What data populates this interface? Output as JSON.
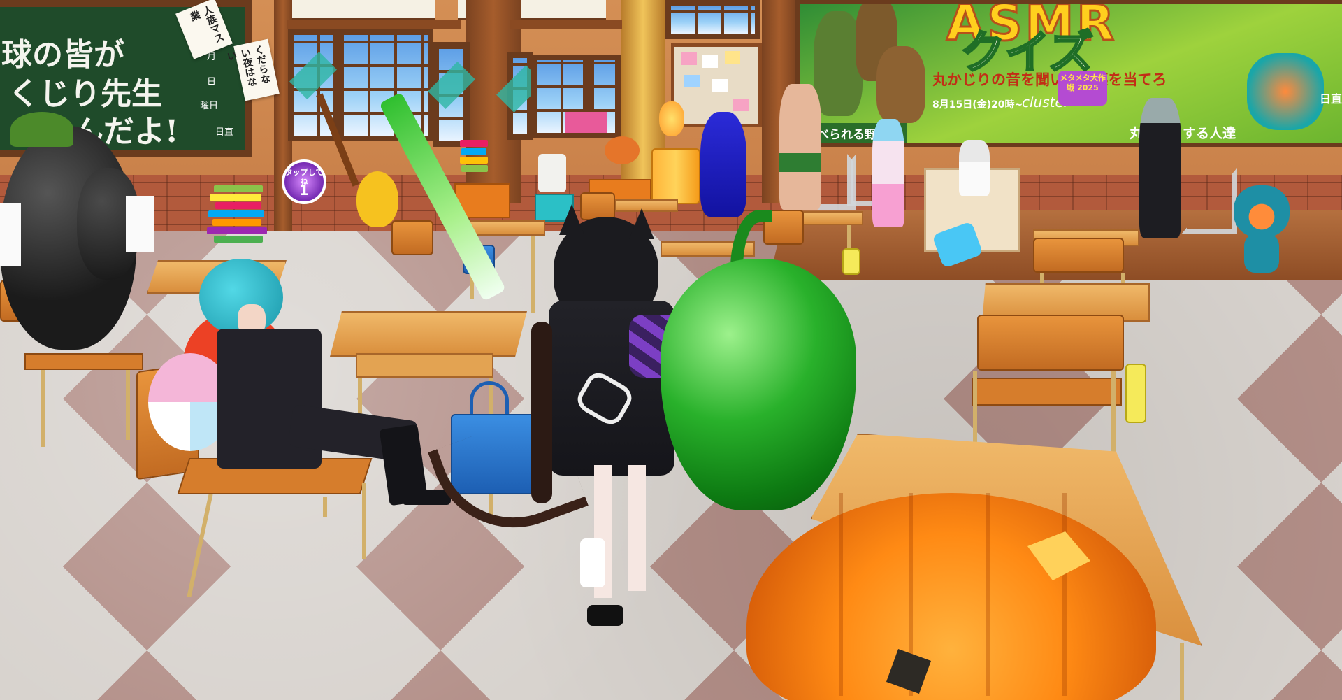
{
  "left_chalkboard": {
    "line1": "球の皆が",
    "line2": "くじり先生",
    "line3": "なんだよ!",
    "date_month": "月",
    "date_day": "日",
    "date_weekday": "曜日",
    "date_duty": "日直"
  },
  "hanging_papers": {
    "paper1": "人族マス業",
    "paper2": "くだらない夜はない"
  },
  "badge": {
    "label": "タップしてね",
    "number": "1"
  },
  "poster": {
    "title": "ASMR",
    "quiz": "クイズ",
    "subtitle": "丸かじりの音を聞いて野菜を当てろ",
    "date": "8月15日(金)20時~",
    "brand": "cluster",
    "logo_text": "メタメタ大作戦 2025",
    "tag_left": "食べられる野菜 5",
    "tag_right": "丸かじりする人達"
  },
  "right_wall_label": "日直",
  "colors": {
    "chalkboard": "#1f4b2a",
    "wood": "#6b3b1d",
    "pepper": "#29b12b",
    "pumpkin": "#ff8a14",
    "poster_green": "#9ed23d"
  }
}
